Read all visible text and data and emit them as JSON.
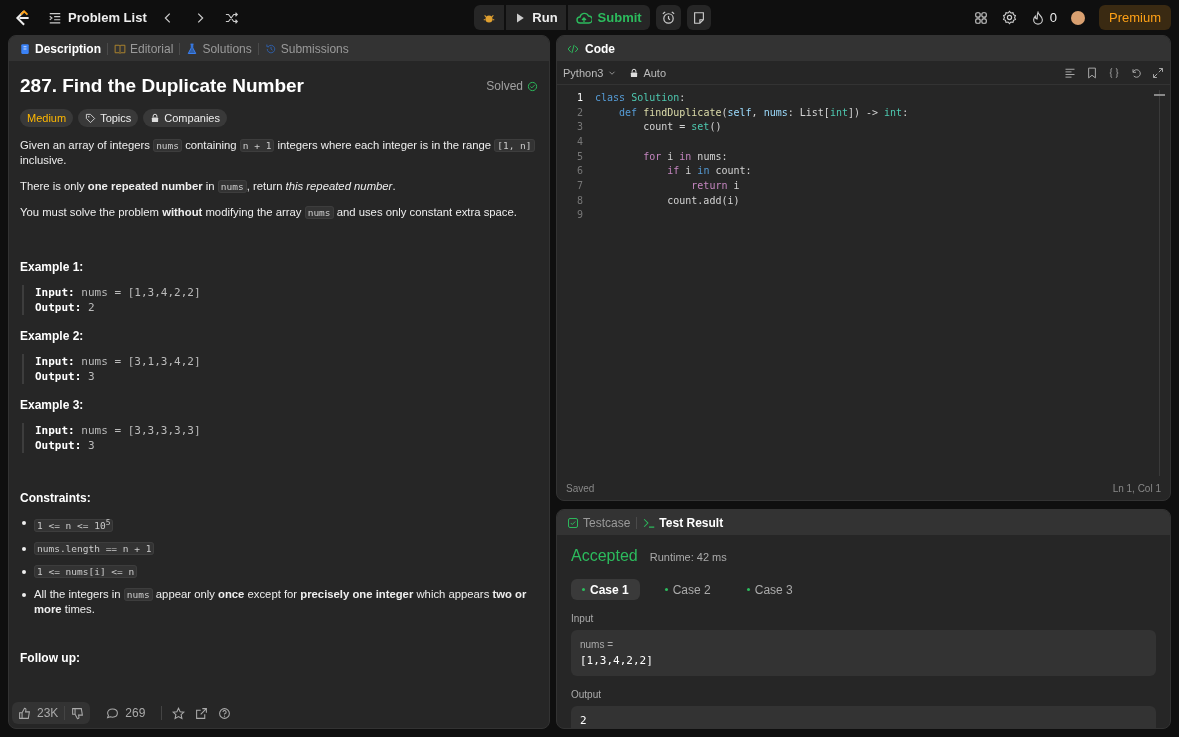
{
  "top_bar": {
    "problem_list": "Problem List",
    "run": "Run",
    "submit": "Submit",
    "streak": "0",
    "premium": "Premium"
  },
  "description_panel": {
    "tabs": [
      {
        "label": "Description",
        "selected": true
      },
      {
        "label": "Editorial",
        "selected": false
      },
      {
        "label": "Solutions",
        "selected": false
      },
      {
        "label": "Submissions",
        "selected": false
      }
    ],
    "title": "287. Find the Duplicate Number",
    "status": "Solved",
    "tags": [
      {
        "kind": "difficulty",
        "label": "Medium"
      },
      {
        "kind": "topics",
        "label": "Topics"
      },
      {
        "kind": "companies",
        "label": "Companies"
      }
    ],
    "paragraphs": [
      [
        {
          "kind": "text",
          "text": "Given an array of integers "
        },
        {
          "kind": "code",
          "text": "nums"
        },
        {
          "kind": "text",
          "text": " containing "
        },
        {
          "kind": "code",
          "text": "n + 1"
        },
        {
          "kind": "text",
          "text": " integers where each integer is in the range "
        },
        {
          "kind": "code",
          "text": "[1, n]"
        },
        {
          "kind": "text",
          "text": " inclusive."
        }
      ],
      [
        {
          "kind": "text",
          "text": "There is only **one repeated number** in "
        },
        {
          "kind": "code",
          "text": "nums"
        },
        {
          "kind": "text",
          "text": ", return *this repeated number*."
        }
      ],
      [
        {
          "kind": "text",
          "text": "You must solve the problem **without** modifying the array "
        },
        {
          "kind": "code",
          "text": "nums"
        },
        {
          "kind": "text",
          "text": " and uses only constant extra space."
        }
      ]
    ],
    "examples": [
      {
        "heading": "Example 1:",
        "lines": [
          "**Input:** nums = [1,3,4,2,2]",
          "**Output:** 2"
        ]
      },
      {
        "heading": "Example 2:",
        "lines": [
          "**Input:** nums = [3,1,3,4,2]",
          "**Output:** 3"
        ]
      },
      {
        "heading": "Example 3:",
        "lines": [
          "**Input:** nums = [3,3,3,3,3]",
          "**Output:** 3"
        ]
      }
    ],
    "constraints_heading": "Constraints:",
    "constraints": [
      [
        {
          "kind": "code",
          "text": "1 <= n <= 10$^{5}$"
        }
      ],
      [
        {
          "kind": "code",
          "text": "nums.length == n + 1"
        }
      ],
      [
        {
          "kind": "code",
          "text": "1 <= nums[i] <= n"
        }
      ],
      [
        {
          "kind": "text",
          "text": "All the integers in "
        },
        {
          "kind": "code",
          "text": "nums"
        },
        {
          "kind": "text",
          "text": " appear only **once** except for **precisely one integer** which appears **two or more** times."
        }
      ]
    ],
    "follow_up_heading": "Follow up:",
    "footer": {
      "likes": "23K",
      "comments": "269"
    }
  },
  "code_panel": {
    "title": "Code",
    "language": "Python3",
    "mode": "Auto",
    "lines": [
      {
        "number": "1",
        "current": true,
        "tokens": [
          {
            "kind": "keyword",
            "text": "class"
          },
          {
            "kind": "type",
            "text": " Solution"
          },
          {
            "kind": "plain",
            "text": ":"
          }
        ]
      },
      {
        "number": "2",
        "current": false,
        "tokens": [
          {
            "kind": "keyword",
            "text": "    def"
          },
          {
            "kind": "function",
            "text": " findDuplicate"
          },
          {
            "kind": "plain",
            "text": "("
          },
          {
            "kind": "param",
            "text": "self"
          },
          {
            "kind": "plain",
            "text": ", "
          },
          {
            "kind": "param",
            "text": "nums"
          },
          {
            "kind": "plain",
            "text": ": List["
          },
          {
            "kind": "type",
            "text": "int"
          },
          {
            "kind": "plain",
            "text": "]) -> "
          },
          {
            "kind": "type",
            "text": "int"
          },
          {
            "kind": "plain",
            "text": ":"
          }
        ]
      },
      {
        "number": "3",
        "current": false,
        "tokens": [
          {
            "kind": "plain",
            "text": "        count = "
          },
          {
            "kind": "type",
            "text": "set"
          },
          {
            "kind": "plain",
            "text": "()"
          }
        ]
      },
      {
        "number": "4",
        "current": false
      },
      {
        "number": "5",
        "current": false,
        "tokens": [
          {
            "kind": "control",
            "text": "        for"
          },
          {
            "kind": "plain",
            "text": " i "
          },
          {
            "kind": "control",
            "text": "in"
          },
          {
            "kind": "plain",
            "text": " nums:"
          }
        ]
      },
      {
        "number": "6",
        "current": false,
        "tokens": [
          {
            "kind": "control",
            "text": "            if"
          },
          {
            "kind": "plain",
            "text": " i "
          },
          {
            "kind": "keyword",
            "text": "in"
          },
          {
            "kind": "plain",
            "text": " count:"
          }
        ]
      },
      {
        "number": "7",
        "current": false,
        "tokens": [
          {
            "kind": "control",
            "text": "                return"
          },
          {
            "kind": "plain",
            "text": " i"
          }
        ]
      },
      {
        "number": "8",
        "current": false,
        "tokens": [
          {
            "kind": "plain",
            "text": "            count.add(i)"
          }
        ]
      },
      {
        "number": "9",
        "current": false
      }
    ],
    "status": "Saved",
    "cursor": "Ln 1, Col 1"
  },
  "result_panel": {
    "tabs": [
      {
        "label": "Testcase",
        "selected": false
      },
      {
        "label": "Test Result",
        "selected": true
      }
    ],
    "verdict": "Accepted",
    "runtime": "Runtime: 42 ms",
    "cases": [
      {
        "label": "Case 1",
        "selected": true
      },
      {
        "label": "Case 2",
        "selected": false
      },
      {
        "label": "Case 3",
        "selected": false
      }
    ],
    "input_label": "Input",
    "input_name": "nums =",
    "input_value": "[1,3,4,2,2]",
    "output_label": "Output",
    "output_value": "2"
  }
}
